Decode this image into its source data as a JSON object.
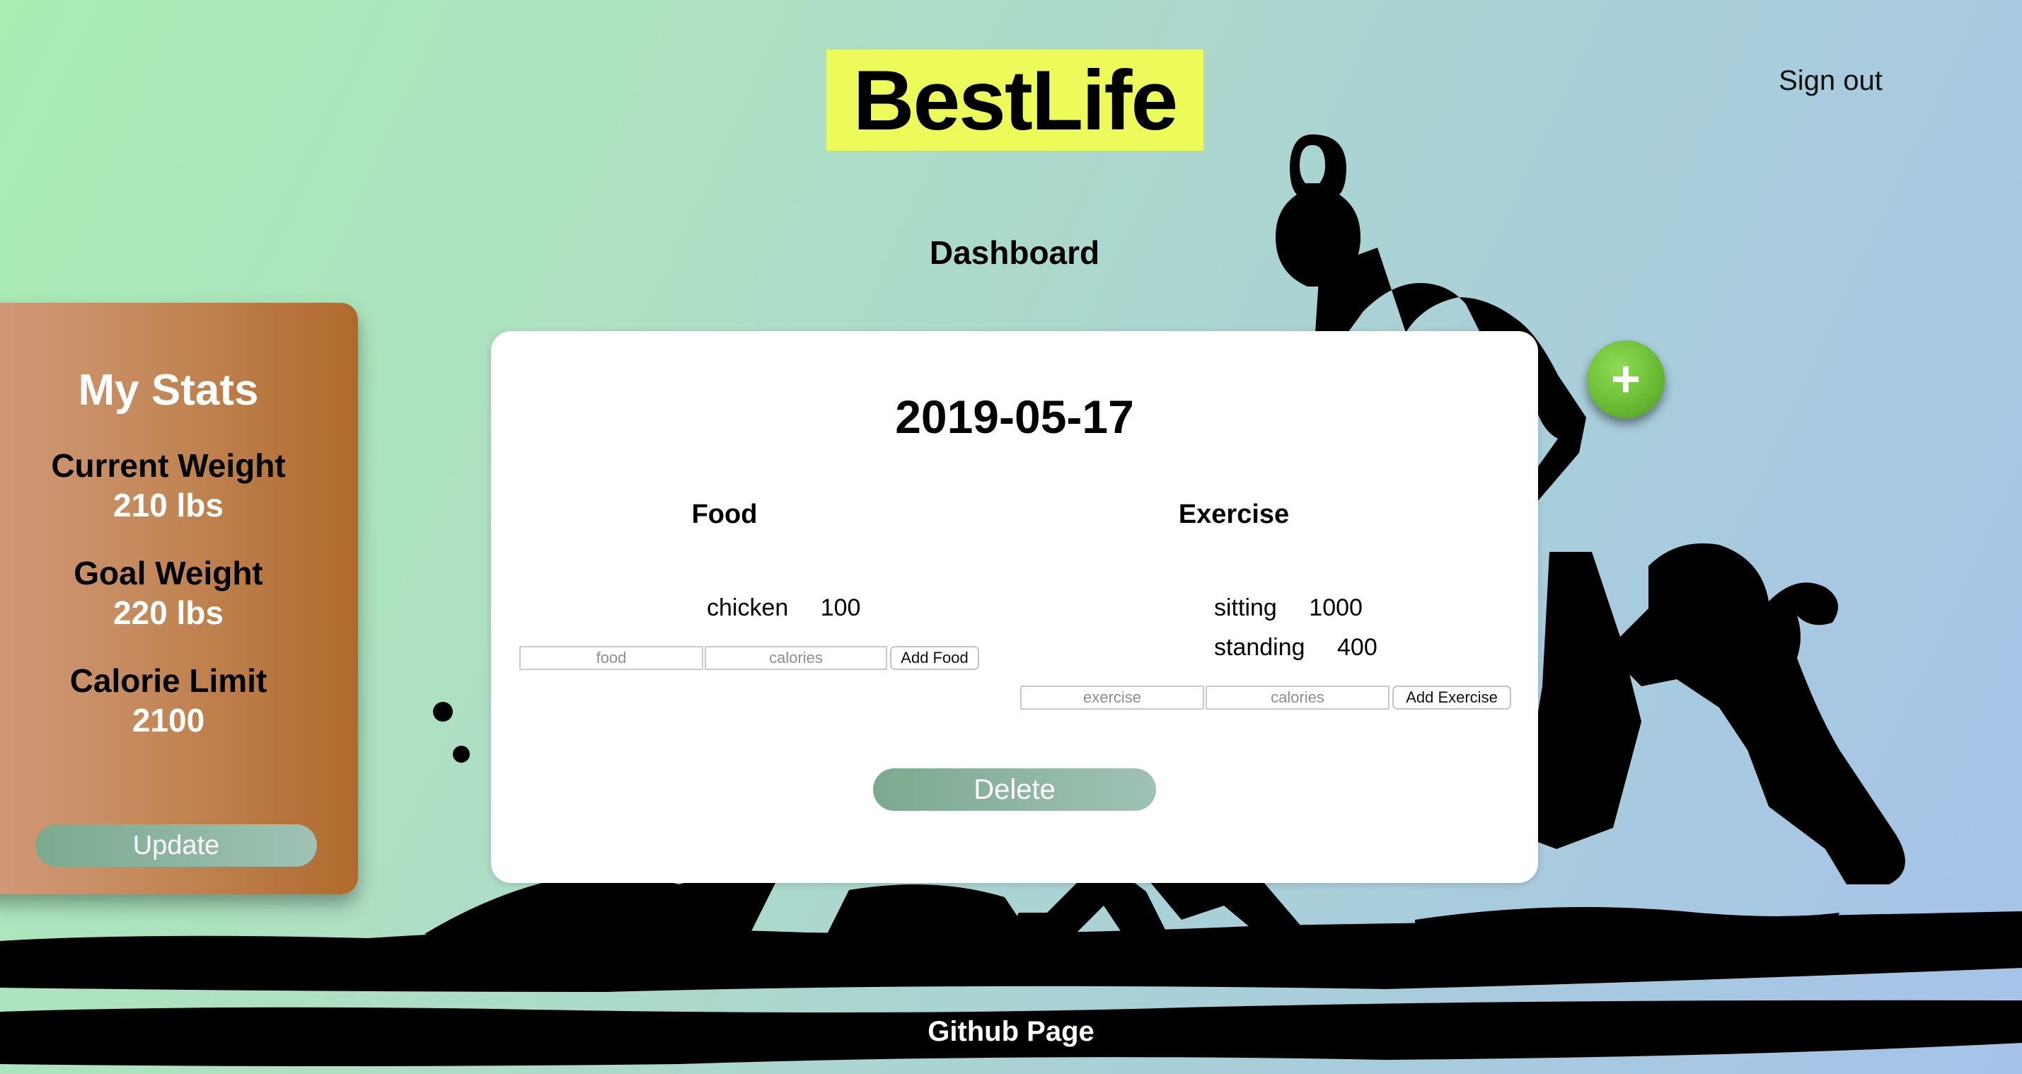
{
  "header": {
    "logo": "BestLife",
    "sign_out": "Sign out"
  },
  "page_title": "Dashboard",
  "stats": {
    "heading": "My Stats",
    "current_weight_label": "Current Weight",
    "current_weight_value": "210 lbs",
    "goal_weight_label": "Goal Weight",
    "goal_weight_value": "220 lbs",
    "calorie_limit_label": "Calorie Limit",
    "calorie_limit_value": "2100",
    "update_button": "Update"
  },
  "day": {
    "date": "2019-05-17",
    "food": {
      "title": "Food",
      "entries": [
        {
          "name": "chicken",
          "calories": "100"
        }
      ],
      "name_placeholder": "food",
      "calories_placeholder": "calories",
      "add_button": "Add Food"
    },
    "exercise": {
      "title": "Exercise",
      "entries": [
        {
          "name": "sitting",
          "calories": "1000"
        },
        {
          "name": "standing",
          "calories": "400"
        }
      ],
      "name_placeholder": "exercise",
      "calories_placeholder": "calories",
      "add_button": "Add Exercise"
    },
    "delete_button": "Delete"
  },
  "add_day_button": "+",
  "footer": {
    "link": "Github Page"
  },
  "colors": {
    "logo_bg": "#ecfb5a",
    "button_green": "#7ba98e",
    "stats_card": "#c4895a",
    "fab": "#6cbd35"
  }
}
